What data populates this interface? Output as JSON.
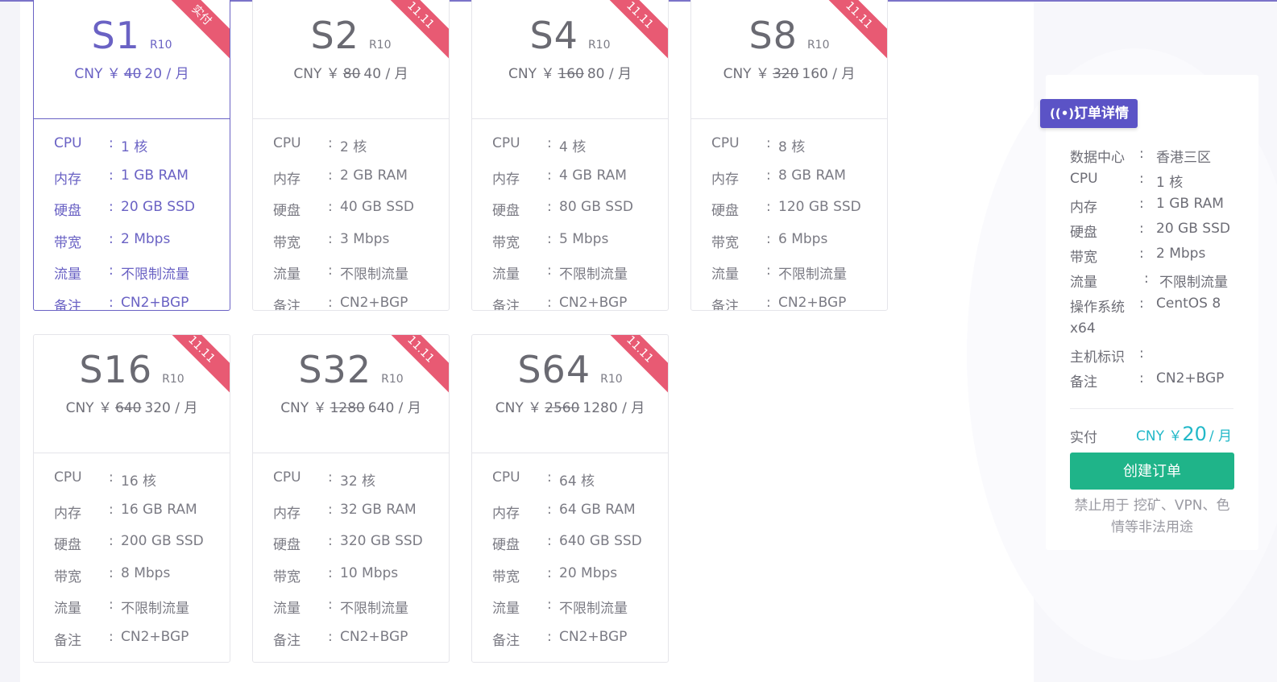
{
  "plans": [
    {
      "name": "S1",
      "code": "R10",
      "currency": "CNY ￥",
      "old_price": "40",
      "price": "20 / 月",
      "ribbon": "实付",
      "cpu": "1 核",
      "ram": "1 GB RAM",
      "disk": "20 GB SSD",
      "bw": "2 Mbps",
      "traffic": "不限制流量",
      "note": "CN2+BGP"
    },
    {
      "name": "S2",
      "code": "R10",
      "currency": "CNY ￥",
      "old_price": "80",
      "price": "40 / 月",
      "ribbon": "11.11",
      "cpu": "2 核",
      "ram": "2 GB RAM",
      "disk": "40 GB SSD",
      "bw": "3 Mbps",
      "traffic": "不限制流量",
      "note": "CN2+BGP"
    },
    {
      "name": "S4",
      "code": "R10",
      "currency": "CNY ￥",
      "old_price": "160",
      "price": "80 / 月",
      "ribbon": "11.11",
      "cpu": "4 核",
      "ram": "4 GB RAM",
      "disk": "80 GB SSD",
      "bw": "5 Mbps",
      "traffic": "不限制流量",
      "note": "CN2+BGP"
    },
    {
      "name": "S8",
      "code": "R10",
      "currency": "CNY ￥",
      "old_price": "320",
      "price": "160 / 月",
      "ribbon": "11.11",
      "cpu": "8 核",
      "ram": "8 GB RAM",
      "disk": "120 GB SSD",
      "bw": "6 Mbps",
      "traffic": "不限制流量",
      "note": "CN2+BGP"
    },
    {
      "name": "S16",
      "code": "R10",
      "currency": "CNY ￥",
      "old_price": "640",
      "price": "320 / 月",
      "ribbon": "11.11",
      "cpu": "16 核",
      "ram": "16 GB RAM",
      "disk": "200 GB SSD",
      "bw": "8 Mbps",
      "traffic": "不限制流量",
      "note": "CN2+BGP"
    },
    {
      "name": "S32",
      "code": "R10",
      "currency": "CNY ￥",
      "old_price": "1280",
      "price": "640 / 月",
      "ribbon": "11.11",
      "cpu": "32 核",
      "ram": "32 GB RAM",
      "disk": "320 GB SSD",
      "bw": "10 Mbps",
      "traffic": "不限制流量",
      "note": "CN2+BGP"
    },
    {
      "name": "S64",
      "code": "R10",
      "currency": "CNY ￥",
      "old_price": "2560",
      "price": "1280 / 月",
      "ribbon": "11.11",
      "cpu": "64 核",
      "ram": "64 GB RAM",
      "disk": "640 GB SSD",
      "bw": "20 Mbps",
      "traffic": "不限制流量",
      "note": "CN2+BGP"
    }
  ],
  "labels": {
    "cpu": "CPU",
    "ram": "内存",
    "disk": "硬盘",
    "bw": "带宽",
    "traffic": "流量",
    "note": "备注",
    "colon": ":"
  },
  "order": {
    "title": "订单详情",
    "dc_label": "数据中心",
    "dc": "香港三区",
    "cpu_label": "CPU",
    "cpu": "1 核",
    "ram_label": "内存",
    "ram": "1 GB RAM",
    "disk_label": "硬盘",
    "disk": "20 GB SSD",
    "bw_label": "带宽",
    "bw": "2 Mbps",
    "traffic_label": "流量",
    "traffic": "不限制流量",
    "os_label": "操作系统",
    "os": "CentOS 8",
    "os_cont": "x64",
    "host_label": "主机标识",
    "host": "",
    "note_label": "备注",
    "note": "CN2+BGP",
    "pay_label": "实付",
    "pay_currency": "CNY ￥",
    "pay_amount": "20",
    "pay_unit": "/ 月",
    "create_button": "创建订单",
    "warning": "禁止用于 挖矿、VPN、色情等非法用途"
  },
  "colors": {
    "accent": "#6a62c4",
    "ribbon": "#e85a73",
    "create": "#1fb489",
    "price": "#22b8c8"
  }
}
